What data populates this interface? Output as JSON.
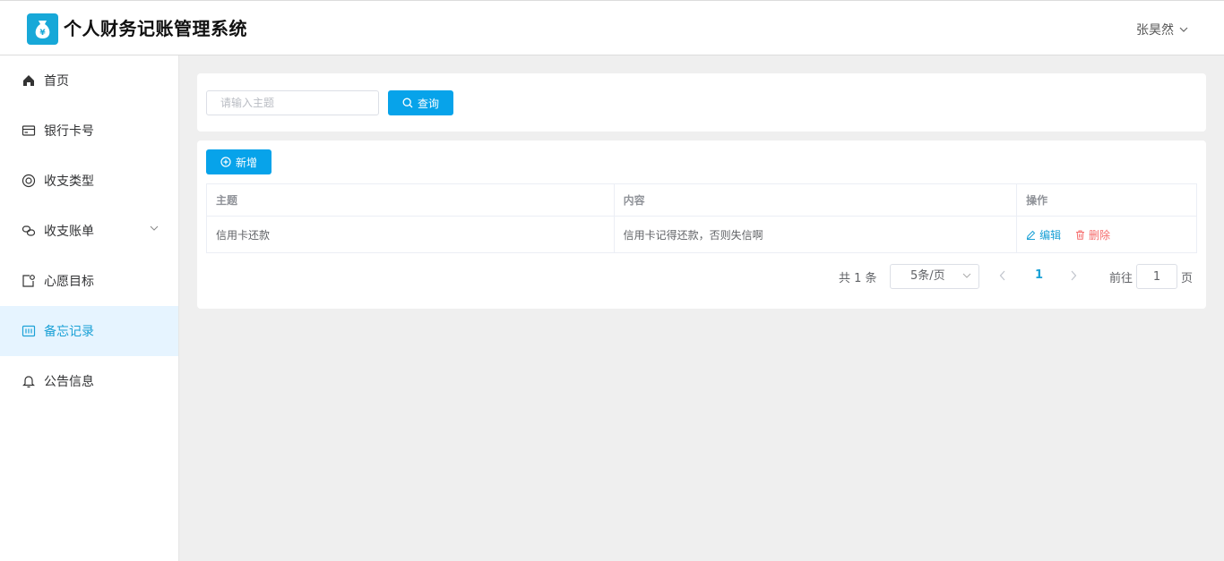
{
  "header": {
    "app_title": "个人财务记账管理系统",
    "logo_icon": "money-bag-icon",
    "user_name": "张昊然"
  },
  "sidebar": {
    "items": [
      {
        "label": "首页",
        "icon": "home-icon"
      },
      {
        "label": "银行卡号",
        "icon": "credit-card-icon"
      },
      {
        "label": "收支类型",
        "icon": "lifebuoy-icon"
      },
      {
        "label": "收支账单",
        "icon": "link-icon",
        "has_submenu": true
      },
      {
        "label": "心愿目标",
        "icon": "goal-icon"
      },
      {
        "label": "备忘记录",
        "icon": "memo-icon",
        "active": true
      },
      {
        "label": "公告信息",
        "icon": "bell-icon"
      }
    ]
  },
  "search": {
    "placeholder": "请输入主题",
    "value": "",
    "button_label": "查询"
  },
  "toolbar": {
    "add_label": "新增"
  },
  "table": {
    "columns": [
      "主题",
      "内容",
      "操作"
    ],
    "rows": [
      {
        "subject": "信用卡还款",
        "content": "信用卡记得还款，否则失信啊",
        "edit_label": "编辑",
        "delete_label": "删除"
      }
    ]
  },
  "pagination": {
    "total_text": "共 1 条",
    "page_size": "5条/页",
    "current_page": "1",
    "goto_label": "前往",
    "goto_value": "1",
    "page_suffix": "页"
  },
  "colors": {
    "primary": "#07a3ea",
    "accent": "#1ba1d6",
    "danger": "#f56c6c",
    "active_bg": "#e6f4ff"
  }
}
